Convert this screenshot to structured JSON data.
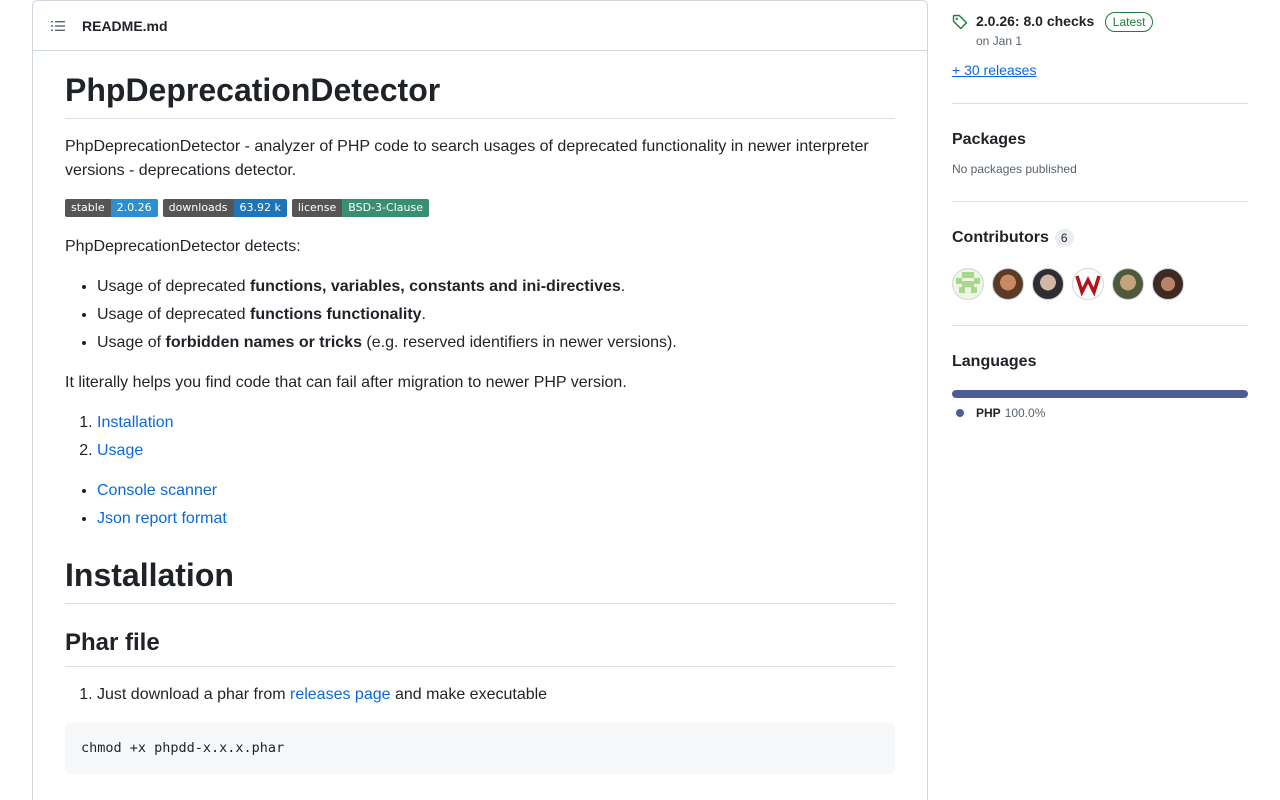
{
  "readme": {
    "filename": "README.md",
    "title": "PhpDeprecationDetector",
    "intro": "PhpDeprecationDetector - analyzer of PHP code to search usages of deprecated functionality in newer interpreter versions - deprecations detector.",
    "badges": [
      {
        "key": "stable",
        "value": "2.0.26",
        "color": "#2f8fce"
      },
      {
        "key": "downloads",
        "value": "63.92 k",
        "color": "#1e74b8"
      },
      {
        "key": "license",
        "value": "BSD-3-Clause",
        "color": "#3a8f70"
      }
    ],
    "detects_intro": "PhpDeprecationDetector detects:",
    "features": [
      {
        "pre": "Usage of deprecated ",
        "bold": "functions, variables, constants and ini-directives",
        "post": "."
      },
      {
        "pre": "Usage of deprecated ",
        "bold": "functions functionality",
        "post": "."
      },
      {
        "pre": "Usage of ",
        "bold": "forbidden names or tricks",
        "post": " (e.g. reserved identifiers in newer versions)."
      }
    ],
    "helps_text": "It literally helps you find code that can fail after migration to newer PHP version.",
    "toc_numbered": [
      "Installation",
      "Usage"
    ],
    "toc_bullets": [
      "Console scanner",
      "Json report format"
    ],
    "install_heading": "Installation",
    "phar_heading": "Phar file",
    "phar_step": {
      "pre": "Just download a phar from ",
      "link": "releases page",
      "post": " and make executable"
    },
    "code": "chmod +x phpdd-x.x.x.phar"
  },
  "sidebar": {
    "release": {
      "name": "2.0.26: 8.0 checks",
      "badge": "Latest",
      "date": "on Jan 1"
    },
    "releases_link": "+ 30 releases",
    "packages": {
      "heading": "Packages",
      "text": "No packages published"
    },
    "contributors": {
      "heading": "Contributors",
      "count": "6"
    },
    "languages": {
      "heading": "Languages",
      "name": "PHP",
      "percent": "100.0%",
      "color": "#4f5d95"
    }
  },
  "colors": {
    "link": "#0969da",
    "border": "#d0d7de",
    "latest": "#1a7f37"
  }
}
